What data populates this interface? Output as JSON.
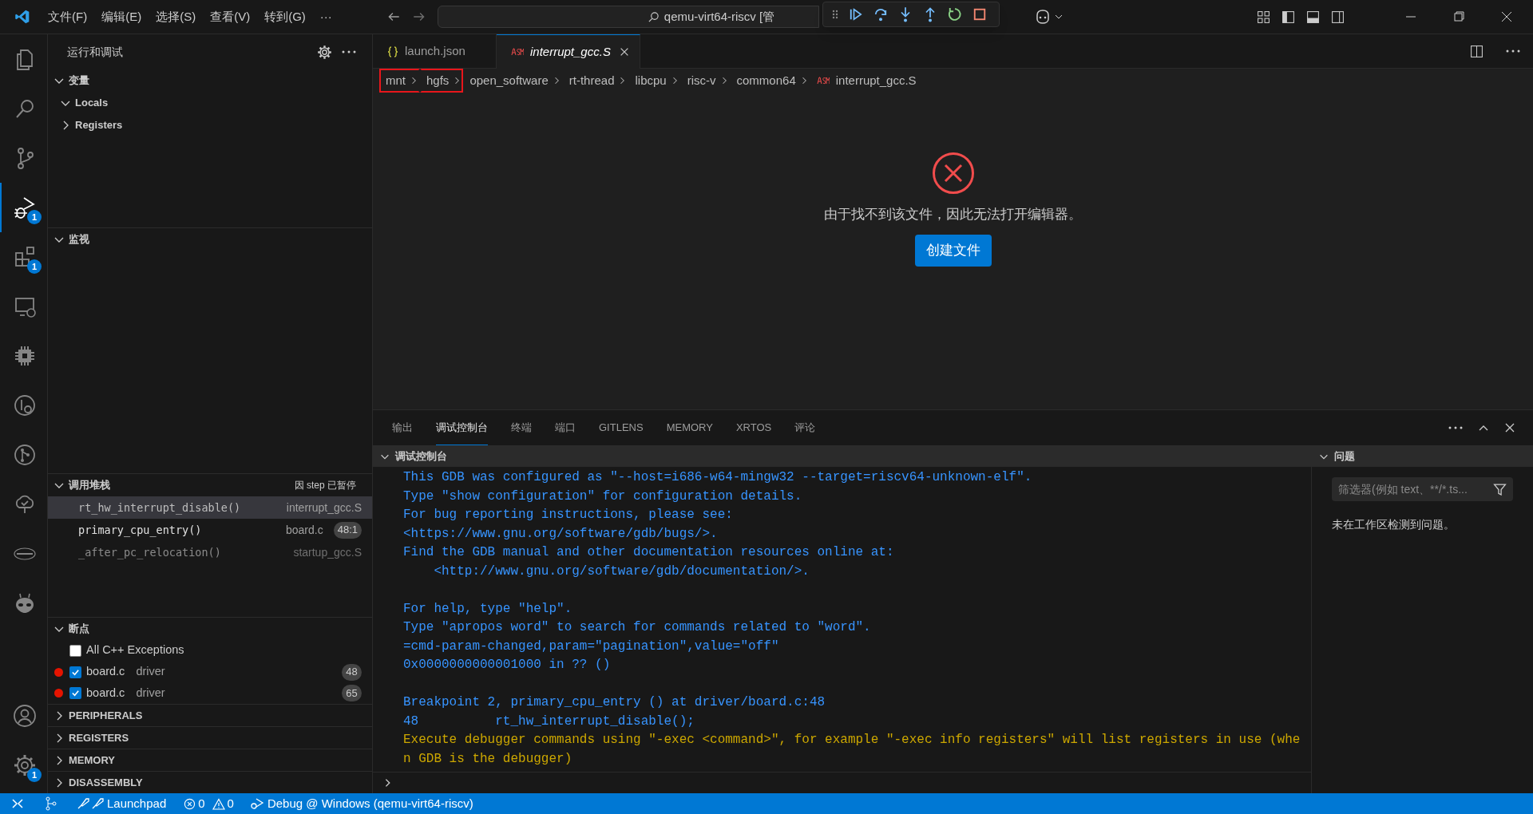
{
  "title_bar": {
    "menus": [
      "文件(F)",
      "编辑(E)",
      "选择(S)",
      "查看(V)",
      "转到(G)",
      "···"
    ],
    "search": "qemu-virt64-riscv [管"
  },
  "activity_bar": {
    "top": [
      {
        "kind": "explorer",
        "selected": false
      },
      {
        "kind": "search",
        "selected": false
      },
      {
        "kind": "source-control",
        "selected": false
      },
      {
        "kind": "debug",
        "selected": true,
        "badge": "1"
      },
      {
        "kind": "extensions",
        "selected": false,
        "badge": "1"
      },
      {
        "kind": "remote",
        "selected": false
      },
      {
        "kind": "chip",
        "selected": false
      },
      {
        "kind": "inspect",
        "selected": false
      },
      {
        "kind": "graph",
        "selected": false
      },
      {
        "kind": "tree",
        "selected": false
      },
      {
        "kind": "logo",
        "selected": false
      },
      {
        "kind": "alien",
        "selected": false
      }
    ],
    "bottom": [
      {
        "kind": "account",
        "selected": false
      },
      {
        "kind": "settings",
        "selected": false,
        "badge": "1"
      }
    ]
  },
  "sidebar": {
    "title": "运行和调试",
    "variables": {
      "title": "变量",
      "expanded": true,
      "children": [
        {
          "label": "Locals",
          "expanded": true
        },
        {
          "label": "Registers",
          "expanded": false
        }
      ]
    },
    "watch": {
      "title": "监视",
      "expanded": true
    },
    "call_stack": {
      "title": "调用堆栈",
      "expanded": true,
      "status": "因 step 已暂停",
      "frames": [
        {
          "name": "rt_hw_interrupt_disable()",
          "file": "interrupt_gcc.S",
          "selected": true,
          "dimmed": false
        },
        {
          "name": "primary_cpu_entry()",
          "file": "board.c",
          "line": "48:1",
          "selected": false,
          "dimmed": false
        },
        {
          "name": "_after_pc_relocation()",
          "file": "startup_gcc.S",
          "selected": false,
          "dimmed": true
        }
      ]
    },
    "breakpoints": {
      "title": "断点",
      "expanded": true,
      "items": [
        {
          "kind": "exception",
          "label": "All C++ Exceptions",
          "checked": false
        },
        {
          "kind": "source",
          "label": "board.c",
          "detail": "driver",
          "line": "48",
          "checked": true
        },
        {
          "kind": "source",
          "label": "board.c",
          "detail": "driver",
          "line": "65",
          "checked": true
        }
      ]
    },
    "collapsed_sections": [
      "PERIPHERALS",
      "REGISTERS",
      "MEMORY",
      "DISASSEMBLY"
    ]
  },
  "editor": {
    "tabs": [
      {
        "kind": "json",
        "label": "launch.json",
        "selected": false,
        "preview": false
      },
      {
        "kind": "asm",
        "label": "interrupt_gcc.S",
        "selected": true,
        "preview": true
      }
    ],
    "breadcrumb": [
      {
        "label": "mnt",
        "highlighted": true
      },
      {
        "label": "hgfs",
        "highlighted": true
      },
      {
        "label": "open_software",
        "highlighted": false
      },
      {
        "label": "rt-thread",
        "highlighted": false
      },
      {
        "label": "libcpu",
        "highlighted": false
      },
      {
        "label": "risc-v",
        "highlighted": false
      },
      {
        "label": "common64",
        "highlighted": false
      },
      {
        "label": "interrupt_gcc.S",
        "highlighted": false,
        "kind": "asm"
      }
    ],
    "error_message": "由于找不到该文件，因此无法打开编辑器。",
    "create_button": "创建文件"
  },
  "panel": {
    "tabs": [
      {
        "label": "输出",
        "selected": false
      },
      {
        "label": "调试控制台",
        "selected": true
      },
      {
        "label": "终端",
        "selected": false
      },
      {
        "label": "端口",
        "selected": false
      },
      {
        "label": "GITLENS",
        "selected": false
      },
      {
        "label": "MEMORY",
        "selected": false
      },
      {
        "label": "XRTOS",
        "selected": false
      },
      {
        "label": "评论",
        "selected": false
      }
    ],
    "console": {
      "title": "调试控制台",
      "lines": [
        {
          "kind": "info",
          "text": "This GDB was configured as \"--host=i686-w64-mingw32 --target=riscv64-unknown-elf\"."
        },
        {
          "kind": "info",
          "text": "Type \"show configuration\" for configuration details."
        },
        {
          "kind": "info",
          "text": "For bug reporting instructions, please see:"
        },
        {
          "kind": "info",
          "text": "<https://www.gnu.org/software/gdb/bugs/>."
        },
        {
          "kind": "info",
          "text": "Find the GDB manual and other documentation resources online at:"
        },
        {
          "kind": "info",
          "text": "    <http://www.gnu.org/software/gdb/documentation/>."
        },
        {
          "kind": "blank"
        },
        {
          "kind": "info",
          "text": "For help, type \"help\"."
        },
        {
          "kind": "info",
          "text": "Type \"apropos word\" to search for commands related to \"word\"."
        },
        {
          "kind": "info",
          "text": "=cmd-param-changed,param=\"pagination\",value=\"off\""
        },
        {
          "kind": "info",
          "text": "0x0000000000001000 in ?? ()"
        },
        {
          "kind": "blank"
        },
        {
          "kind": "info",
          "text": "Breakpoint 2, primary_cpu_entry () at driver/board.c:48"
        },
        {
          "kind": "info",
          "text": "48          rt_hw_interrupt_disable();"
        },
        {
          "kind": "warn",
          "text": "Execute debugger commands using \"-exec <command>\", for example \"-exec info registers\" will list registers in use (when GDB is the debugger)"
        }
      ]
    },
    "problems": {
      "title": "问题",
      "filter_placeholder": "筛选器(例如 text、**/*.ts...",
      "message": "未在工作区检测到问题。"
    }
  },
  "status_bar": {
    "launchpad": "Launchpad",
    "errors": "0",
    "warnings": "0",
    "debug": "Debug @ Windows (qemu-virt64-riscv)"
  }
}
